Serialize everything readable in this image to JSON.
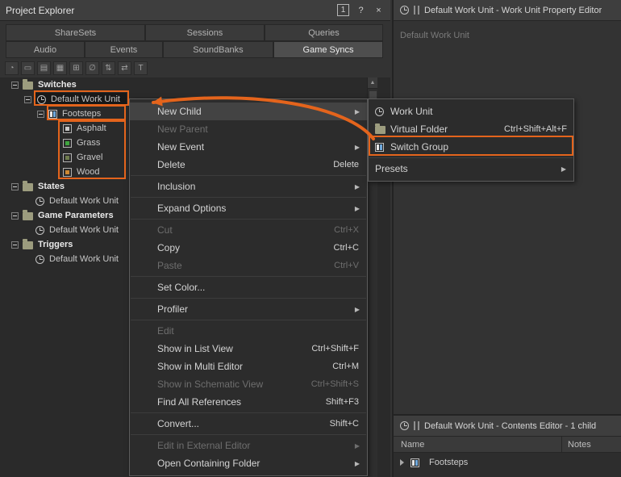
{
  "accent": {
    "annotation": "#e4641c"
  },
  "ui": {
    "submenu_arrow": "▶",
    "scroll_up_arrow": "▲"
  },
  "window": {
    "title": "Project Explorer",
    "pin_label": "1",
    "help_label": "?",
    "close_label": "×"
  },
  "tabs": {
    "row1": [
      {
        "label": "ShareSets"
      },
      {
        "label": "Sessions"
      },
      {
        "label": "Queries"
      }
    ],
    "row2": [
      {
        "label": "Audio"
      },
      {
        "label": "Events"
      },
      {
        "label": "SoundBanks"
      },
      {
        "label": "Game Syncs"
      }
    ],
    "active_tab": "Game Syncs"
  },
  "toolbar": {
    "icons": [
      {
        "name": "work-unit",
        "glyph": "◔"
      },
      {
        "name": "folder",
        "glyph": "▭"
      },
      {
        "name": "list-view",
        "glyph": "▤"
      },
      {
        "name": "grid-view",
        "glyph": "▦"
      },
      {
        "name": "add",
        "glyph": "⊞"
      },
      {
        "name": "filter-none",
        "glyph": "∅"
      },
      {
        "name": "sort",
        "glyph": "⇅"
      },
      {
        "name": "sync",
        "glyph": "⇄"
      },
      {
        "name": "text",
        "glyph": "T"
      }
    ]
  },
  "tree": {
    "items": [
      {
        "label": "Switches"
      },
      {
        "label": "Default Work Unit"
      },
      {
        "label": "Footsteps"
      },
      {
        "label": "Asphalt",
        "color": "#c8c8c8"
      },
      {
        "label": "Grass",
        "color": "#3fa53f"
      },
      {
        "label": "Gravel",
        "color": "#6e7c4e"
      },
      {
        "label": "Wood",
        "color": "#cc8833"
      },
      {
        "label": "States"
      },
      {
        "label": "Default Work Unit"
      },
      {
        "label": "Game Parameters"
      },
      {
        "label": "Default Work Unit"
      },
      {
        "label": "Triggers"
      },
      {
        "label": "Default Work Unit"
      }
    ]
  },
  "context_menu": {
    "items": [
      {
        "label": "New Child"
      },
      {
        "label": "New Parent"
      },
      {
        "label": "New Event"
      },
      {
        "label": "Delete",
        "shortcut": "Delete"
      },
      {
        "label": "Inclusion"
      },
      {
        "label": "Expand Options"
      },
      {
        "label": "Cut",
        "shortcut": "Ctrl+X"
      },
      {
        "label": "Copy",
        "shortcut": "Ctrl+C"
      },
      {
        "label": "Paste",
        "shortcut": "Ctrl+V"
      },
      {
        "label": "Set Color..."
      },
      {
        "label": "Profiler"
      },
      {
        "label": "Edit"
      },
      {
        "label": "Show in List View",
        "shortcut": "Ctrl+Shift+F"
      },
      {
        "label": "Show in Multi Editor",
        "shortcut": "Ctrl+M"
      },
      {
        "label": "Show in Schematic View",
        "shortcut": "Ctrl+Shift+S"
      },
      {
        "label": "Find All References",
        "shortcut": "Shift+F3"
      },
      {
        "label": "Convert...",
        "shortcut": "Shift+C"
      },
      {
        "label": "Edit in External Editor"
      },
      {
        "label": "Open Containing Folder"
      }
    ]
  },
  "submenu": {
    "items": [
      {
        "label": "Work Unit"
      },
      {
        "label": "Virtual Folder",
        "shortcut": "Ctrl+Shift+Alt+F"
      },
      {
        "label": "Switch Group"
      },
      {
        "label": "Presets"
      }
    ]
  },
  "property_editor": {
    "title": "Default Work Unit - Work Unit Property Editor",
    "object_label": "Default Work Unit"
  },
  "contents_editor": {
    "title": "Default Work Unit - Contents Editor - 1 child",
    "columns": [
      {
        "label": "Name"
      },
      {
        "label": "Notes"
      }
    ],
    "rows": [
      {
        "name": "Footsteps"
      }
    ]
  }
}
